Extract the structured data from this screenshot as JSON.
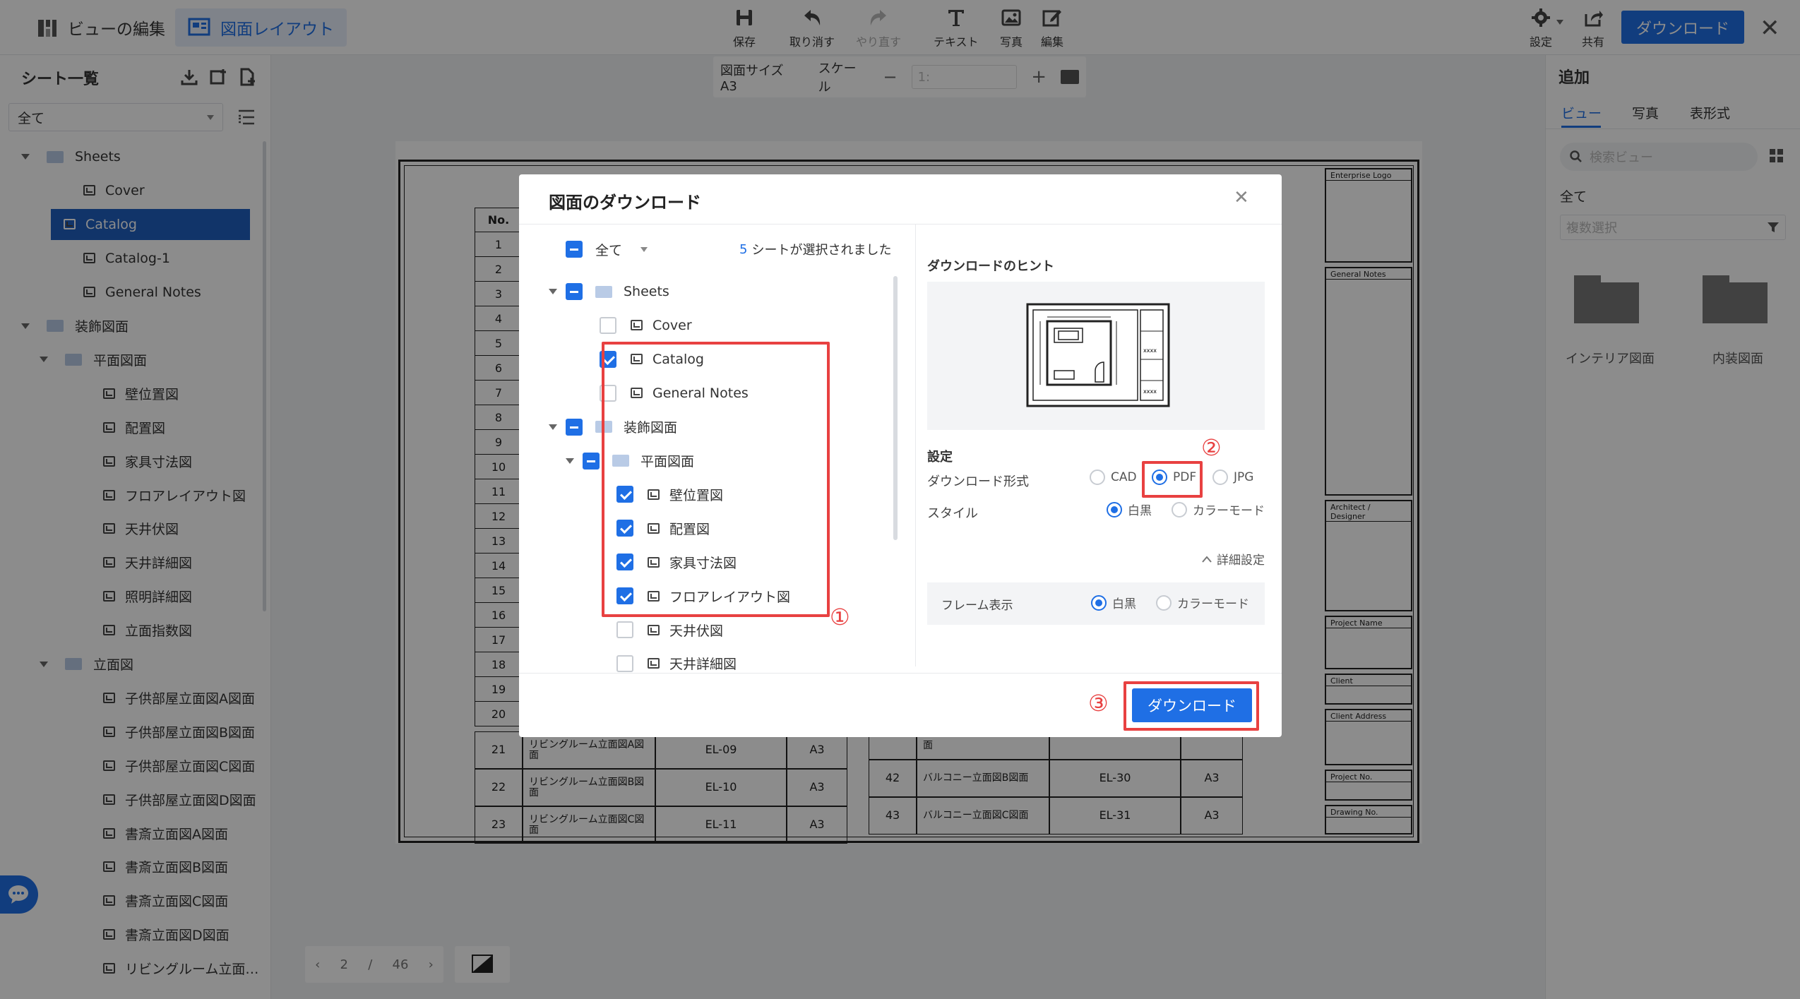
{
  "topbar": {
    "tab_view_edit": "ビューの編集",
    "tab_layout": "図面レイアウト",
    "tools": [
      "保存",
      "取り消す",
      "やり直す",
      "テキスト",
      "写真",
      "編集"
    ],
    "settings_label": "設定",
    "share_label": "共有",
    "download_label": "ダウンロード"
  },
  "canvas_toolbar": {
    "paper_size": "図面サイズ A3",
    "scale_label": "スケール",
    "scale_value": "1:"
  },
  "sidebar": {
    "title": "シート一覧",
    "filter_value": "全て",
    "items": [
      {
        "label": "Sheets",
        "type": "folder",
        "level": 0
      },
      {
        "label": "Cover",
        "type": "sheet",
        "level": 1
      },
      {
        "label": "Catalog",
        "type": "sheet",
        "level": 1,
        "selected": true
      },
      {
        "label": "Catalog-1",
        "type": "sheet",
        "level": 1
      },
      {
        "label": "General Notes",
        "type": "sheet",
        "level": 1
      },
      {
        "label": "装飾図面",
        "type": "folder",
        "level": 0
      },
      {
        "label": "平面図面",
        "type": "folder",
        "level": 1
      },
      {
        "label": "壁位置図",
        "type": "sheet",
        "level": 2
      },
      {
        "label": "配置図",
        "type": "sheet",
        "level": 2
      },
      {
        "label": "家具寸法図",
        "type": "sheet",
        "level": 2
      },
      {
        "label": "フロアレイアウト図",
        "type": "sheet",
        "level": 2
      },
      {
        "label": "天井伏図",
        "type": "sheet",
        "level": 2
      },
      {
        "label": "天井詳細図",
        "type": "sheet",
        "level": 2
      },
      {
        "label": "照明詳細図",
        "type": "sheet",
        "level": 2
      },
      {
        "label": "立面指数図",
        "type": "sheet",
        "level": 2
      },
      {
        "label": "立面図",
        "type": "folder",
        "level": 1
      },
      {
        "label": "子供部屋立面図A図面",
        "type": "sheet",
        "level": 2
      },
      {
        "label": "子供部屋立面図B図面",
        "type": "sheet",
        "level": 2
      },
      {
        "label": "子供部屋立面図C図面",
        "type": "sheet",
        "level": 2
      },
      {
        "label": "子供部屋立面図D図面",
        "type": "sheet",
        "level": 2
      },
      {
        "label": "書斎立面図A図面",
        "type": "sheet",
        "level": 2
      },
      {
        "label": "書斎立面図B図面",
        "type": "sheet",
        "level": 2
      },
      {
        "label": "書斎立面図C図面",
        "type": "sheet",
        "level": 2
      },
      {
        "label": "書斎立面図D図面",
        "type": "sheet",
        "level": 2
      },
      {
        "label": "リビングルーム立面…",
        "type": "sheet",
        "level": 2
      }
    ]
  },
  "pager": {
    "current": "2",
    "separator": "/",
    "total": "46"
  },
  "right_panel": {
    "title": "追加",
    "tabs": [
      "ビュー",
      "写真",
      "表形式"
    ],
    "search_placeholder": "検索ビュー",
    "section": "全て",
    "multi_select": "複数選択",
    "folders": [
      "インテリア図面",
      "内装図面"
    ]
  },
  "sheet": {
    "header_no": "No.",
    "rows_left": [
      "1",
      "2",
      "3",
      "4",
      "5",
      "6",
      "7",
      "8",
      "9",
      "10",
      "11",
      "12",
      "13",
      "14",
      "15",
      "16",
      "17",
      "18",
      "19",
      "20"
    ],
    "bottom_rows": [
      {
        "no": "21",
        "name": "リビングルーム立面図A図面",
        "code": "EL-09",
        "size": "A3"
      },
      {
        "no": "22",
        "name": "リビングルーム立面図B図面",
        "code": "EL-10",
        "size": "A3"
      },
      {
        "no": "23",
        "name": "リビングルーム立面図C図面",
        "code": "EL-11",
        "size": "A3"
      }
    ],
    "bottom_rows_right": [
      {
        "no": "",
        "name": "面",
        "code": "",
        "size": ""
      },
      {
        "no": "42",
        "name": "バルコニー立面図B図面",
        "code": "EL-30",
        "size": "A3"
      },
      {
        "no": "43",
        "name": "バルコニー立面図C図面",
        "code": "EL-31",
        "size": "A3"
      }
    ],
    "title_block": [
      "Enterprise Logo",
      "General Notes",
      "Architect / Designer",
      "Project Name",
      "Client",
      "Client Address",
      "Project No.",
      "Drawing No."
    ]
  },
  "modal": {
    "title": "図面のダウンロード",
    "select_all": "全て",
    "selected_count": "5",
    "selected_suffix": "シートが選択されました",
    "tree": [
      {
        "label": "Sheets",
        "type": "folder",
        "level": 0,
        "check": "ind",
        "caret": true
      },
      {
        "label": "Cover",
        "type": "sheet",
        "level": 1,
        "check": "off"
      },
      {
        "label": "Catalog",
        "type": "sheet",
        "level": 1,
        "check": "on"
      },
      {
        "label": "General Notes",
        "type": "sheet",
        "level": 1,
        "check": "off"
      },
      {
        "label": "装飾図面",
        "type": "folder",
        "level": 0,
        "check": "ind",
        "caret": true
      },
      {
        "label": "平面図面",
        "type": "folder",
        "level": 1,
        "check": "ind",
        "caret": true
      },
      {
        "label": "壁位置図",
        "type": "sheet",
        "level": 2,
        "check": "on"
      },
      {
        "label": "配置図",
        "type": "sheet",
        "level": 2,
        "check": "on"
      },
      {
        "label": "家具寸法図",
        "type": "sheet",
        "level": 2,
        "check": "on"
      },
      {
        "label": "フロアレイアウト図",
        "type": "sheet",
        "level": 2,
        "check": "on"
      },
      {
        "label": "天井伏図",
        "type": "sheet",
        "level": 2,
        "check": "off"
      },
      {
        "label": "天井詳細図",
        "type": "sheet",
        "level": 2,
        "check": "off"
      }
    ],
    "hint_title": "ダウンロードのヒント",
    "settings_title": "設定",
    "format_label": "ダウンロード形式",
    "formats": [
      "CAD",
      "PDF",
      "JPG"
    ],
    "format_selected": "PDF",
    "style_label": "スタイル",
    "styles": [
      "白黒",
      "カラーモード"
    ],
    "style_selected": "白黒",
    "advanced": "詳細設定",
    "frame_label": "フレーム表示",
    "frame_options": [
      "白黒",
      "カラーモード"
    ],
    "frame_selected": "白黒",
    "download_button": "ダウンロード",
    "annotations": [
      "①",
      "②",
      "③"
    ]
  },
  "colors": {
    "accent": "#1f6fe5",
    "annotation": "#e84141",
    "selected_row": "#1f5fbf"
  }
}
